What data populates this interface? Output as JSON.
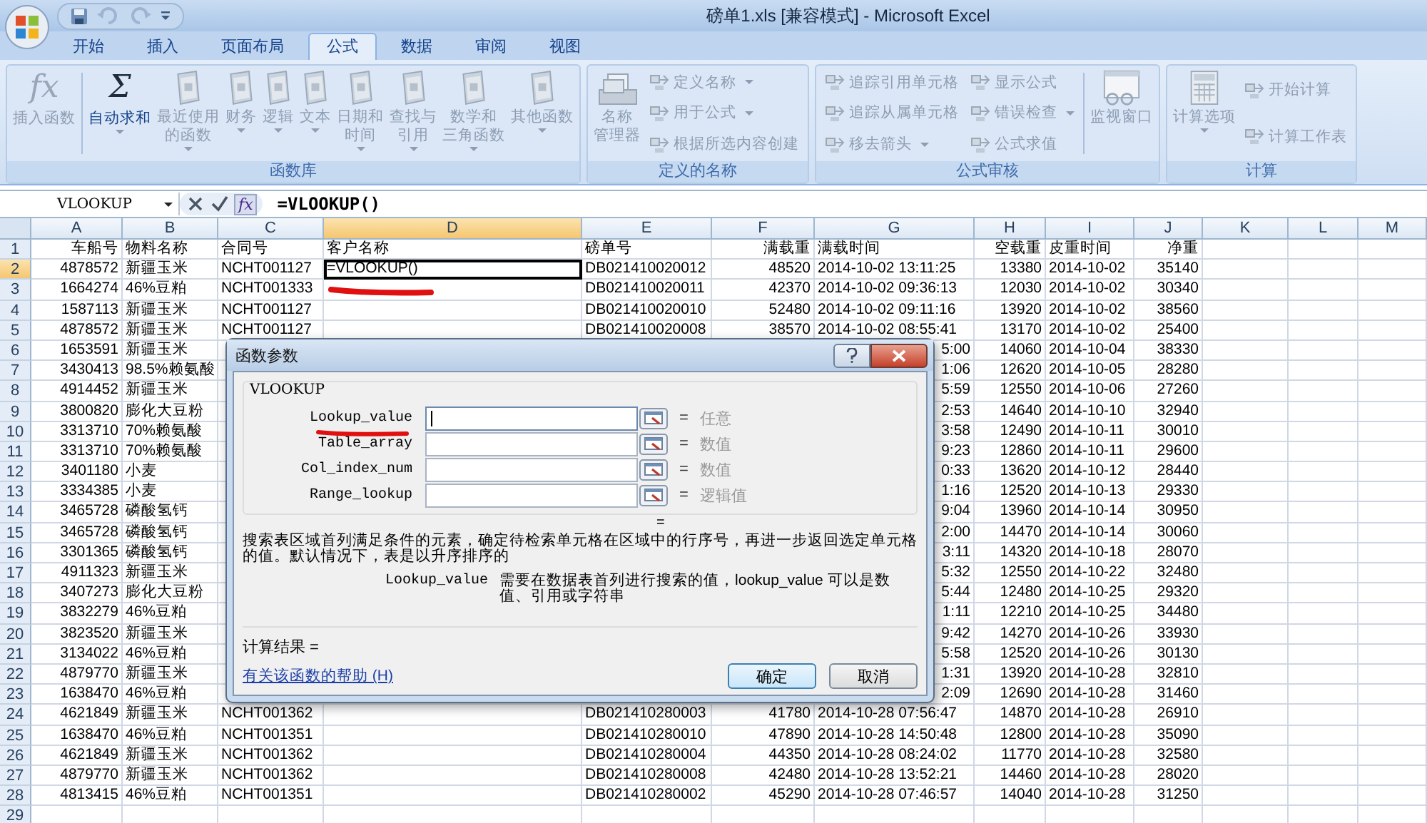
{
  "window": {
    "title": "磅单1.xls  [兼容模式] - Microsoft Excel"
  },
  "quick_access": [
    {
      "kind": "save"
    },
    {
      "kind": "undo"
    },
    {
      "kind": "redo"
    },
    {
      "kind": "customize"
    }
  ],
  "tabs": [
    {
      "label": "开始",
      "selected": false
    },
    {
      "label": "插入",
      "selected": false
    },
    {
      "label": "页面布局",
      "selected": false
    },
    {
      "label": "公式",
      "selected": true
    },
    {
      "label": "数据",
      "selected": false
    },
    {
      "label": "审阅",
      "selected": false
    },
    {
      "label": "视图",
      "selected": false
    }
  ],
  "ribbon": {
    "groups": [
      {
        "title": "函数库",
        "items": [
          {
            "kind": "glyph",
            "glyph": "fx",
            "label": [
              "插入函数"
            ],
            "dropdown": false,
            "disabled": true
          },
          {
            "kind": "separator"
          },
          {
            "kind": "glyph",
            "glyph": "Σ",
            "label": [
              "自动求和"
            ],
            "dropdown": true,
            "disabled": false
          },
          {
            "kind": "book",
            "label": [
              "最近使用",
              "的函数"
            ],
            "dropdown": true,
            "disabled": true
          },
          {
            "kind": "book",
            "label": [
              "财务"
            ],
            "dropdown": true,
            "disabled": true
          },
          {
            "kind": "book",
            "label": [
              "逻辑"
            ],
            "dropdown": true,
            "disabled": true
          },
          {
            "kind": "book",
            "label": [
              "文本"
            ],
            "dropdown": true,
            "disabled": true
          },
          {
            "kind": "book",
            "label": [
              "日期和",
              "时间"
            ],
            "dropdown": true,
            "disabled": true
          },
          {
            "kind": "book",
            "label": [
              "查找与",
              "引用"
            ],
            "dropdown": true,
            "disabled": true
          },
          {
            "kind": "book",
            "label": [
              "数学和",
              "三角函数"
            ],
            "dropdown": true,
            "disabled": true
          },
          {
            "kind": "book",
            "label": [
              "其他函数"
            ],
            "dropdown": true,
            "disabled": true
          }
        ]
      },
      {
        "title": "定义的名称",
        "items": [
          {
            "kind": "cards",
            "label": [
              "名称",
              "管理器"
            ],
            "dropdown": false,
            "disabled": true
          },
          {
            "kind": "stack",
            "items": [
              {
                "label": "定义名称",
                "dropdown": true,
                "disabled": true
              },
              {
                "label": "用于公式",
                "dropdown": true,
                "disabled": true
              },
              {
                "label": "根据所选内容创建",
                "dropdown": false,
                "disabled": true
              }
            ]
          }
        ]
      },
      {
        "title": "公式审核",
        "items": [
          {
            "kind": "stack",
            "items": [
              {
                "label": "追踪引用单元格",
                "dropdown": false,
                "disabled": true
              },
              {
                "label": "追踪从属单元格",
                "dropdown": false,
                "disabled": true
              },
              {
                "label": "移去箭头",
                "dropdown": true,
                "disabled": true
              }
            ]
          },
          {
            "kind": "stack",
            "items": [
              {
                "label": "显示公式",
                "dropdown": false,
                "disabled": true
              },
              {
                "label": "错误检查",
                "dropdown": true,
                "disabled": true
              },
              {
                "label": "公式求值",
                "dropdown": false,
                "disabled": true
              }
            ]
          },
          {
            "kind": "separator"
          },
          {
            "kind": "window",
            "label": [
              "监视窗口"
            ],
            "dropdown": false,
            "disabled": true
          }
        ]
      },
      {
        "title": "计算",
        "items": [
          {
            "kind": "calculator",
            "label": [
              "计算选项"
            ],
            "dropdown": true,
            "disabled": true
          },
          {
            "kind": "stack",
            "items": [
              {
                "label": "开始计算",
                "dropdown": false,
                "disabled": true
              },
              {
                "label": "计算工作表",
                "dropdown": false,
                "disabled": true
              }
            ]
          }
        ]
      }
    ]
  },
  "formula_bar": {
    "name_box": "VLOOKUP",
    "buttons": [
      {
        "kind": "cancel"
      },
      {
        "kind": "enter"
      },
      {
        "kind": "function",
        "glyph": "fx"
      }
    ],
    "formula": "=VLOOKUP()"
  },
  "sheet": {
    "columns": [
      {
        "label": "A",
        "kind": "number",
        "selected": false
      },
      {
        "label": "B",
        "kind": "text",
        "selected": false
      },
      {
        "label": "C",
        "kind": "text",
        "selected": false
      },
      {
        "label": "D",
        "kind": "text",
        "selected": true
      },
      {
        "label": "E",
        "kind": "text",
        "selected": false
      },
      {
        "label": "F",
        "kind": "number",
        "selected": false
      },
      {
        "label": "G",
        "kind": "text",
        "selected": false
      },
      {
        "label": "H",
        "kind": "number",
        "selected": false
      },
      {
        "label": "I",
        "kind": "text",
        "selected": false
      },
      {
        "label": "J",
        "kind": "number",
        "selected": false
      },
      {
        "label": "K",
        "selected": false
      },
      {
        "label": "L",
        "selected": false
      },
      {
        "label": "M",
        "selected": false
      }
    ],
    "rows": [
      {
        "number": "1",
        "selected": false,
        "covered": false,
        "cells": [
          "车船号",
          "物料名称",
          "合同号",
          "客户名称",
          "磅单号",
          "满载重",
          "满载时间",
          "空载重",
          "皮重时间",
          "净重"
        ]
      },
      {
        "number": "2",
        "selected": true,
        "covered": false,
        "cells": [
          "4878572",
          "新疆玉米",
          "NCHT001127",
          {
            "text": "=VLOOKUP()",
            "active": true
          },
          "DB021410020012",
          "48520",
          "2014-10-02 13:11:25",
          "13380",
          "2014-10-02",
          "35140"
        ]
      },
      {
        "number": "3",
        "selected": false,
        "covered": false,
        "cells": [
          "1664274",
          "46%豆粕",
          "NCHT001333",
          null,
          "DB021410020011",
          "42370",
          "2014-10-02 09:36:13",
          "12030",
          "2014-10-02",
          "30340"
        ]
      },
      {
        "number": "4",
        "selected": false,
        "covered": false,
        "cells": [
          "1587113",
          "新疆玉米",
          "NCHT001127",
          null,
          "DB021410020010",
          "52480",
          "2014-10-02 09:11:16",
          "13920",
          "2014-10-02",
          "38560"
        ]
      },
      {
        "number": "5",
        "selected": false,
        "covered": false,
        "cells": [
          "4878572",
          "新疆玉米",
          "NCHT001127",
          null,
          "DB021410020008",
          "38570",
          "2014-10-02 08:55:41",
          "13170",
          "2014-10-02",
          "25400"
        ]
      },
      {
        "number": "6",
        "selected": false,
        "covered": true,
        "cells": [
          "1653591",
          "新疆玉米",
          null,
          null,
          null,
          null,
          "5:00",
          "14060",
          "2014-10-04",
          "38330"
        ]
      },
      {
        "number": "7",
        "selected": false,
        "covered": true,
        "cells": [
          "3430413",
          "98.5%赖氨酸",
          null,
          null,
          null,
          null,
          "1:06",
          "12620",
          "2014-10-05",
          "28280"
        ]
      },
      {
        "number": "8",
        "selected": false,
        "covered": true,
        "cells": [
          "4914452",
          "新疆玉米",
          null,
          null,
          null,
          null,
          "5:59",
          "12550",
          "2014-10-06",
          "27260"
        ]
      },
      {
        "number": "9",
        "selected": false,
        "covered": true,
        "cells": [
          "3800820",
          "膨化大豆粉",
          null,
          null,
          null,
          null,
          "2:53",
          "14640",
          "2014-10-10",
          "32940"
        ]
      },
      {
        "number": "10",
        "selected": false,
        "covered": true,
        "cells": [
          "3313710",
          "70%赖氨酸",
          null,
          null,
          null,
          null,
          "3:58",
          "12490",
          "2014-10-11",
          "30010"
        ]
      },
      {
        "number": "11",
        "selected": false,
        "covered": true,
        "cells": [
          "3313710",
          "70%赖氨酸",
          null,
          null,
          null,
          null,
          "9:23",
          "12860",
          "2014-10-11",
          "29600"
        ]
      },
      {
        "number": "12",
        "selected": false,
        "covered": true,
        "cells": [
          "3401180",
          "小麦",
          null,
          null,
          null,
          null,
          "0:33",
          "13620",
          "2014-10-12",
          "28440"
        ]
      },
      {
        "number": "13",
        "selected": false,
        "covered": true,
        "cells": [
          "3334385",
          "小麦",
          null,
          null,
          null,
          null,
          "1:16",
          "12520",
          "2014-10-13",
          "29330"
        ]
      },
      {
        "number": "14",
        "selected": false,
        "covered": true,
        "cells": [
          "3465728",
          "磷酸氢钙",
          null,
          null,
          null,
          null,
          "9:04",
          "13960",
          "2014-10-14",
          "30950"
        ]
      },
      {
        "number": "15",
        "selected": false,
        "covered": true,
        "cells": [
          "3465728",
          "磷酸氢钙",
          null,
          null,
          null,
          null,
          "2:00",
          "14470",
          "2014-10-14",
          "30060"
        ]
      },
      {
        "number": "16",
        "selected": false,
        "covered": true,
        "cells": [
          "3301365",
          "磷酸氢钙",
          null,
          null,
          null,
          null,
          "3:11",
          "14320",
          "2014-10-18",
          "28070"
        ]
      },
      {
        "number": "17",
        "selected": false,
        "covered": true,
        "cells": [
          "4911323",
          "新疆玉米",
          null,
          null,
          null,
          null,
          "5:32",
          "12550",
          "2014-10-22",
          "32480"
        ]
      },
      {
        "number": "18",
        "selected": false,
        "covered": true,
        "cells": [
          "3407273",
          "膨化大豆粉",
          null,
          null,
          null,
          null,
          "5:44",
          "12480",
          "2014-10-25",
          "29320"
        ]
      },
      {
        "number": "19",
        "selected": false,
        "covered": true,
        "cells": [
          "3832279",
          "46%豆粕",
          null,
          null,
          null,
          null,
          "1:11",
          "12210",
          "2014-10-25",
          "34480"
        ]
      },
      {
        "number": "20",
        "selected": false,
        "covered": true,
        "cells": [
          "3823520",
          "新疆玉米",
          null,
          null,
          null,
          null,
          "9:42",
          "14270",
          "2014-10-26",
          "33930"
        ]
      },
      {
        "number": "21",
        "selected": false,
        "covered": true,
        "cells": [
          "3134022",
          "46%豆粕",
          null,
          null,
          null,
          null,
          "5:58",
          "12520",
          "2014-10-26",
          "30130"
        ]
      },
      {
        "number": "22",
        "selected": false,
        "covered": true,
        "cells": [
          "4879770",
          "新疆玉米",
          null,
          null,
          null,
          null,
          "1:31",
          "13920",
          "2014-10-28",
          "32810"
        ]
      },
      {
        "number": "23",
        "selected": false,
        "covered": true,
        "cells": [
          "1638470",
          "46%豆粕",
          null,
          null,
          null,
          null,
          "2:09",
          "12690",
          "2014-10-28",
          "31460"
        ]
      },
      {
        "number": "24",
        "selected": false,
        "covered": false,
        "cells": [
          "4621849",
          "新疆玉米",
          "NCHT001362",
          null,
          "DB021410280003",
          "41780",
          "2014-10-28 07:56:47",
          "14870",
          "2014-10-28",
          "26910"
        ]
      },
      {
        "number": "25",
        "selected": false,
        "covered": false,
        "cells": [
          "1638470",
          "46%豆粕",
          "NCHT001351",
          null,
          "DB021410280010",
          "47890",
          "2014-10-28 14:50:48",
          "12800",
          "2014-10-28",
          "35090"
        ]
      },
      {
        "number": "26",
        "selected": false,
        "covered": false,
        "cells": [
          "4621849",
          "新疆玉米",
          "NCHT001362",
          null,
          "DB021410280004",
          "44350",
          "2014-10-28 08:24:02",
          "11770",
          "2014-10-28",
          "32580"
        ]
      },
      {
        "number": "27",
        "selected": false,
        "covered": false,
        "cells": [
          "4879770",
          "新疆玉米",
          "NCHT001362",
          null,
          "DB021410280008",
          "42480",
          "2014-10-28 13:52:21",
          "14460",
          "2014-10-28",
          "28020"
        ]
      },
      {
        "number": "28",
        "selected": false,
        "covered": false,
        "cells": [
          "4813415",
          "46%豆粕",
          "NCHT001351",
          null,
          "DB021410280002",
          "45290",
          "2014-10-28 07:46:57",
          "14040",
          "2014-10-28",
          "31250"
        ]
      },
      {
        "number": "29",
        "selected": false,
        "covered": false,
        "cells": []
      }
    ]
  },
  "dialog": {
    "title": "函数参数",
    "function": "VLOOKUP",
    "arguments": [
      {
        "name": "Lookup_value",
        "focused": true,
        "equals": "=",
        "hint": "任意"
      },
      {
        "name": "Table_array",
        "focused": false,
        "equals": "=",
        "hint": "数值"
      },
      {
        "name": "Col_index_num",
        "focused": false,
        "equals": "=",
        "hint": "数值"
      },
      {
        "name": "Range_lookup",
        "focused": false,
        "equals": "=",
        "hint": "逻辑值"
      }
    ],
    "result_equals": "=",
    "description": "搜索表区域首列满足条件的元素，确定待检索单元格在区域中的行序号，再进一步返回选定单元格的值。默认情况下，表是以升序排序的",
    "argument_help": {
      "name": "Lookup_value",
      "text": "需要在数据表首列进行搜索的值，lookup_value 可以是数值、引用或字符串"
    },
    "result_label": "计算结果 =",
    "help_link": "有关该函数的帮助 (H)",
    "buttons": [
      {
        "label": "确定",
        "default": true
      },
      {
        "label": "取消",
        "default": false
      }
    ]
  }
}
